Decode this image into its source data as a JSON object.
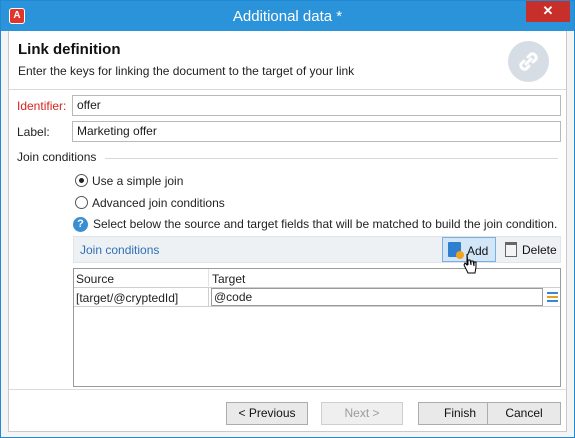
{
  "window": {
    "title": "Additional data *",
    "close_glyph": "✕",
    "app_icon_glyph": "A"
  },
  "header": {
    "title": "Link definition",
    "subtitle": "Enter the keys for linking the document to the target of your link",
    "icon": "link-icon"
  },
  "fields": {
    "identifier_label": "Identifier:",
    "identifier_value": "offer",
    "label_label": "Label:",
    "label_value": "Marketing offer"
  },
  "join": {
    "group_label": "Join conditions",
    "simple_join_label": "Use a simple join",
    "simple_join_checked": true,
    "advanced_join_label": "Advanced join conditions",
    "advanced_join_checked": false,
    "help_text": "Select below the source and target fields that will be matched to build the join condition."
  },
  "toolbar": {
    "title": "Join conditions",
    "add_label": "Add",
    "delete_label": "Delete"
  },
  "table": {
    "columns": [
      "Source",
      "Target"
    ],
    "rows": [
      {
        "source": "[target/@cryptedId]",
        "target": "@code"
      }
    ]
  },
  "footer": {
    "previous_label": "< Previous",
    "next_label": "Next >",
    "finish_label": "Finish",
    "cancel_label": "Cancel"
  },
  "colors": {
    "titlebar": "#2b93d9",
    "close": "#c7302a",
    "required": "#d6241e",
    "link": "#2e6fb8"
  }
}
